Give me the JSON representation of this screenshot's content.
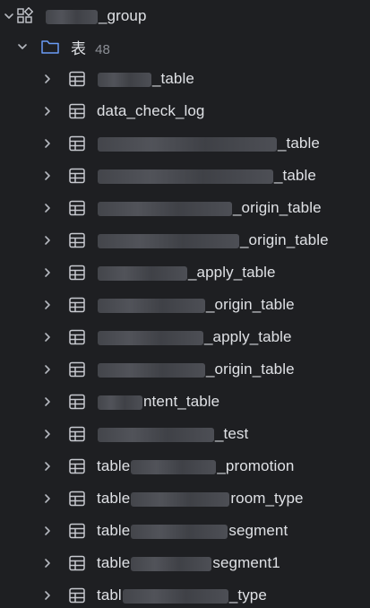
{
  "tree": {
    "group": {
      "label": "_group",
      "expanded": true
    },
    "folder": {
      "label": "表",
      "count": "48",
      "expanded": true
    },
    "tables": [
      {
        "label": "_table",
        "redacted_prefix": true
      },
      {
        "label": "data_check_log",
        "redacted_prefix": false
      },
      {
        "label": "_table",
        "redacted_prefix": true
      },
      {
        "label": "_table",
        "redacted_prefix": true
      },
      {
        "label": "_origin_table",
        "redacted_prefix": true
      },
      {
        "label": "_origin_table",
        "redacted_prefix": true
      },
      {
        "label": "_apply_table",
        "redacted_prefix": true
      },
      {
        "label": "_origin_table",
        "redacted_prefix": true
      },
      {
        "label": "_apply_table",
        "redacted_prefix": true
      },
      {
        "label": "_origin_table",
        "redacted_prefix": true
      },
      {
        "label": "ntent_table",
        "redacted_prefix": true
      },
      {
        "label": "_test",
        "redacted_prefix": true
      },
      {
        "label": "_promotion",
        "prefix": "table"
      },
      {
        "label": "room_type",
        "prefix": "table"
      },
      {
        "label": "segment",
        "prefix": "table"
      },
      {
        "label": "segment1",
        "prefix": "table"
      },
      {
        "label": "_type",
        "prefix": "tabl"
      }
    ]
  },
  "colors": {
    "background": "#1e1f22",
    "text": "#dfe1e5",
    "muted": "#8c8f96",
    "folder_icon": "#6a9cf6",
    "table_icon": "#c7c9cf"
  }
}
